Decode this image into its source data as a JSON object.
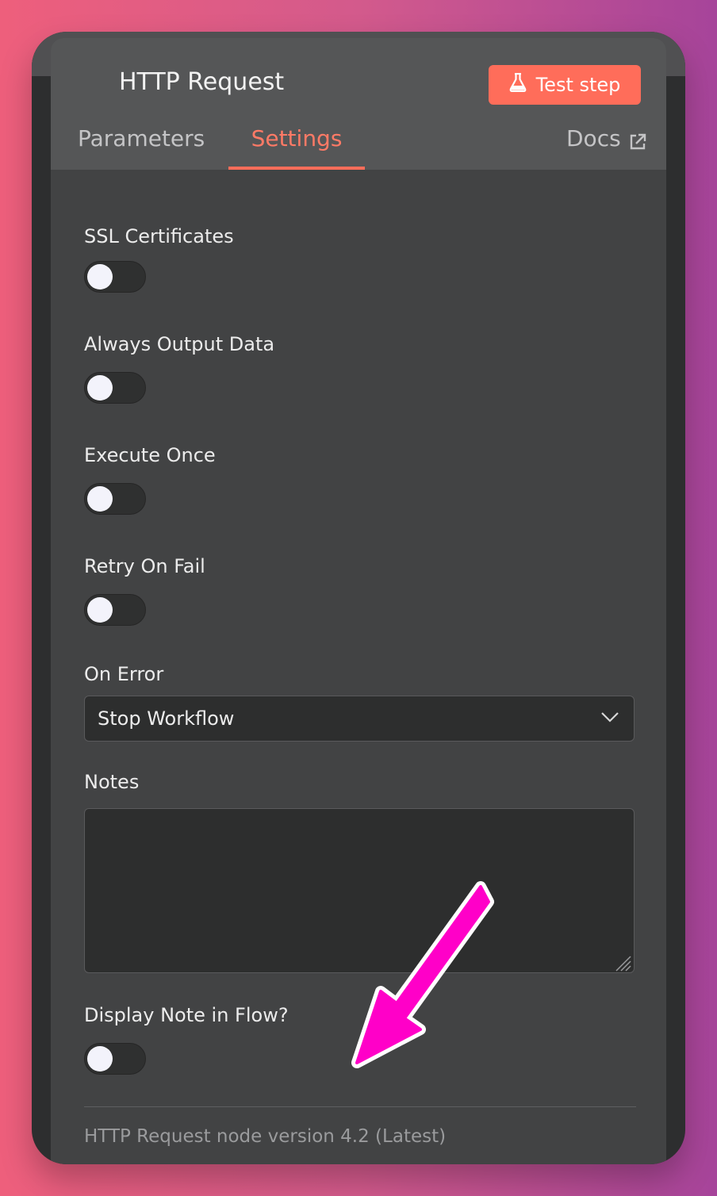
{
  "panel": {
    "title": "HTTP Request",
    "test_step_label": "Test step"
  },
  "tabs": [
    {
      "label": "Parameters",
      "active": false
    },
    {
      "label": "Settings",
      "active": true
    },
    {
      "label": "Docs",
      "active": false
    }
  ],
  "settings": {
    "ssl_certificates": {
      "label": "SSL Certificates",
      "enabled": false
    },
    "always_output_data": {
      "label": "Always Output Data",
      "enabled": false
    },
    "execute_once": {
      "label": "Execute Once",
      "enabled": false
    },
    "retry_on_fail": {
      "label": "Retry On Fail",
      "enabled": false
    },
    "on_error": {
      "label": "On Error",
      "value": "Stop Workflow"
    },
    "notes": {
      "label": "Notes",
      "value": ""
    },
    "display_note": {
      "label": "Display Note in Flow?",
      "enabled": false
    }
  },
  "footer": {
    "version": "HTTP Request node version 4.2 (Latest)"
  },
  "colors": {
    "accent": "#ff6d5a",
    "annotation_arrow": "#ff00c8",
    "panel_bg": "#424344",
    "header_bg": "#555657"
  },
  "icons": {
    "test_step": "flask-icon",
    "docs": "external-link-icon",
    "select": "chevron-down-icon"
  }
}
